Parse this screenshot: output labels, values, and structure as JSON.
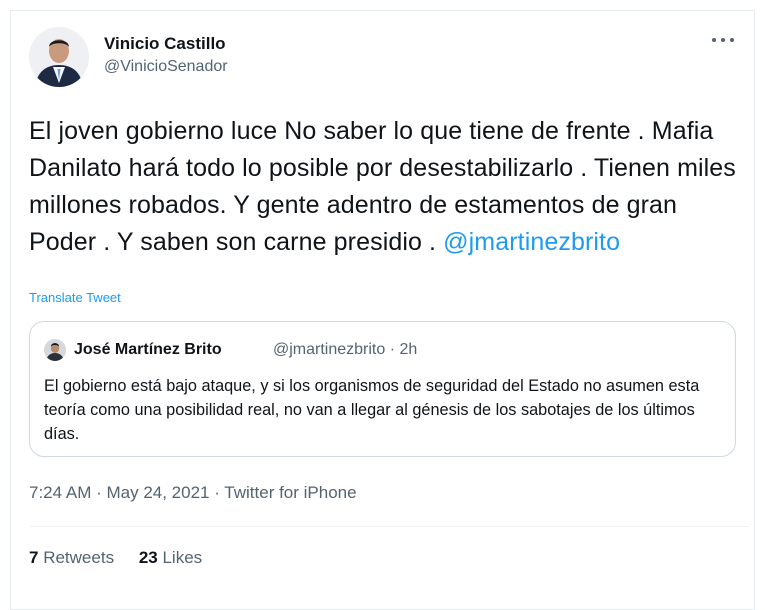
{
  "author": {
    "name": "Vinicio Castillo",
    "handle": "@VinicioSenador"
  },
  "tweet": {
    "text": "El joven gobierno luce No saber lo que tiene de frente . Mafia Danilato hará todo lo posible por desestabilizarlo . Tienen miles millones robados. Y gente adentro de estamentos de gran Poder . Y saben son carne presidio . ",
    "mention": "@jmartinezbrito",
    "translate_label": "Translate Tweet"
  },
  "quoted": {
    "name": "José Martínez Brito",
    "meta": "@jmartinezbrito · 2h",
    "text": "El gobierno está bajo ataque, y si los organismos de seguridad del Estado no asumen esta teoría como una posibilidad real, no van a llegar al génesis de los sabotajes de los últimos días."
  },
  "timestamp": "7:24 AM · May 24, 2021 · Twitter for iPhone",
  "stats": {
    "retweets_count": "7",
    "retweets_label": "Retweets",
    "likes_count": "23",
    "likes_label": "Likes"
  },
  "colors": {
    "link": "#1d9bf0",
    "secondary_text": "#536471",
    "border": "#cfd9de"
  },
  "icons": {
    "more": "more-horizontal-icon"
  }
}
